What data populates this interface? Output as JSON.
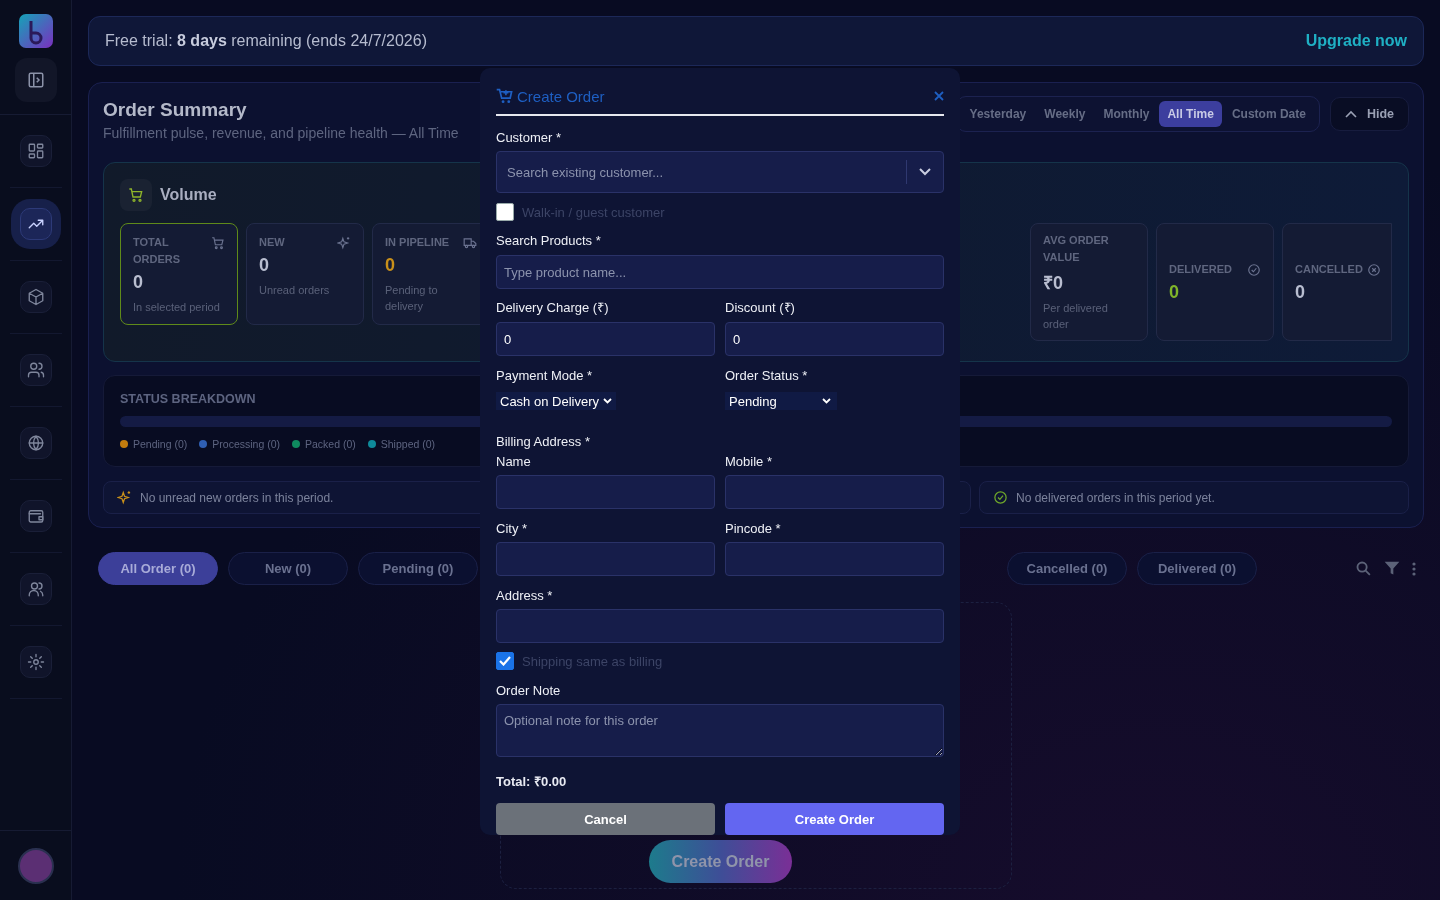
{
  "sidebar": {
    "items": [
      {
        "selected": false
      },
      {
        "selected": true
      },
      {
        "selected": false
      },
      {
        "selected": false
      },
      {
        "selected": false
      },
      {
        "selected": false
      },
      {
        "selected": false
      },
      {
        "selected": false
      }
    ]
  },
  "trial_banner": {
    "text": "Free trial: **8 days** remaining (ends 24/7/2026)",
    "action": "Upgrade now"
  },
  "summary": {
    "title": "Order Summary",
    "subtitle": "Fulfillment pulse, revenue, and pipeline health — All Time",
    "periods": [
      {
        "label": "Yesterday",
        "selected": false
      },
      {
        "label": "Weekly",
        "selected": false
      },
      {
        "label": "Monthly",
        "selected": false
      },
      {
        "label": "All Time",
        "selected": true
      },
      {
        "label": "Custom Date",
        "selected": false
      }
    ],
    "hide_button": "Hide",
    "volume": {
      "title": "Volume",
      "cards": [
        {
          "label": "TOTAL ORDERS",
          "value": "0",
          "caption": "In selected period",
          "color": "#b9bed0",
          "highlighted": true
        },
        {
          "label": "NEW",
          "value": "0",
          "caption": "Unread orders",
          "color": "#b9bed0",
          "highlighted": false
        },
        {
          "label": "IN PIPELINE",
          "value": "0",
          "caption": "Pending to delivery",
          "color": "#c9901a",
          "highlighted": false
        },
        {
          "label": "AVG ORDER VALUE",
          "value": "₹0",
          "caption": "Per delivered order",
          "color": "#b9bed0",
          "highlighted": false
        },
        {
          "label": "DELIVERED",
          "value": "0",
          "color": "#7fb52a",
          "highlighted": false
        },
        {
          "label": "CANCELLED",
          "value": "0",
          "color": "#b9bed0",
          "highlighted": false
        }
      ]
    },
    "status_breakdown": {
      "title": "STATUS BREAKDOWN",
      "legend": [
        {
          "label": "Pending (0)",
          "color": "#c27c0e"
        },
        {
          "label": "Processing (0)",
          "color": "#2f5fb3"
        },
        {
          "label": "Packed (0)",
          "color": "#0f8a5f"
        },
        {
          "label": "Shipped (0)",
          "color": "#0e8a9a"
        }
      ]
    },
    "alerts": [
      {
        "kind": "sparkle",
        "text": "No unread new orders in this period."
      },
      {
        "kind": "check",
        "text": "No delivered orders in this period yet."
      }
    ]
  },
  "order_tabs": [
    {
      "label": "All Order (0)",
      "selected": true
    },
    {
      "label": "New (0)",
      "selected": false
    },
    {
      "label": "Pending (0)",
      "selected": false
    },
    {
      "label": "Cancelled (0)",
      "selected": false
    },
    {
      "label": "Delivered (0)",
      "selected": false
    }
  ],
  "empty_state": {
    "button": "Create Order"
  },
  "modal": {
    "title": "Create Order",
    "customer": {
      "label": "Customer *",
      "placeholder": "Search existing customer..."
    },
    "walk_in": {
      "label": "Walk-in / guest customer",
      "checked": false
    },
    "products": {
      "label": "Search Products *",
      "placeholder": "Type product name..."
    },
    "delivery_charge": {
      "label": "Delivery Charge (₹)",
      "value": "0"
    },
    "discount": {
      "label": "Discount (₹)",
      "value": "0"
    },
    "payment_mode": {
      "label": "Payment Mode *",
      "value": "Cash on Delivery"
    },
    "order_status": {
      "label": "Order Status *",
      "value": "Pending"
    },
    "billing_title": "Billing Address *",
    "name": {
      "label": "Name"
    },
    "mobile": {
      "label": "Mobile *"
    },
    "city": {
      "label": "City *"
    },
    "pincode": {
      "label": "Pincode *"
    },
    "address": {
      "label": "Address *"
    },
    "shipping_same": {
      "label": "Shipping same as billing",
      "checked": true
    },
    "note": {
      "label": "Order Note",
      "placeholder": "Optional note for this order"
    },
    "total": "Total: ₹0.00",
    "cancel": "Cancel",
    "submit": "Create Order"
  }
}
